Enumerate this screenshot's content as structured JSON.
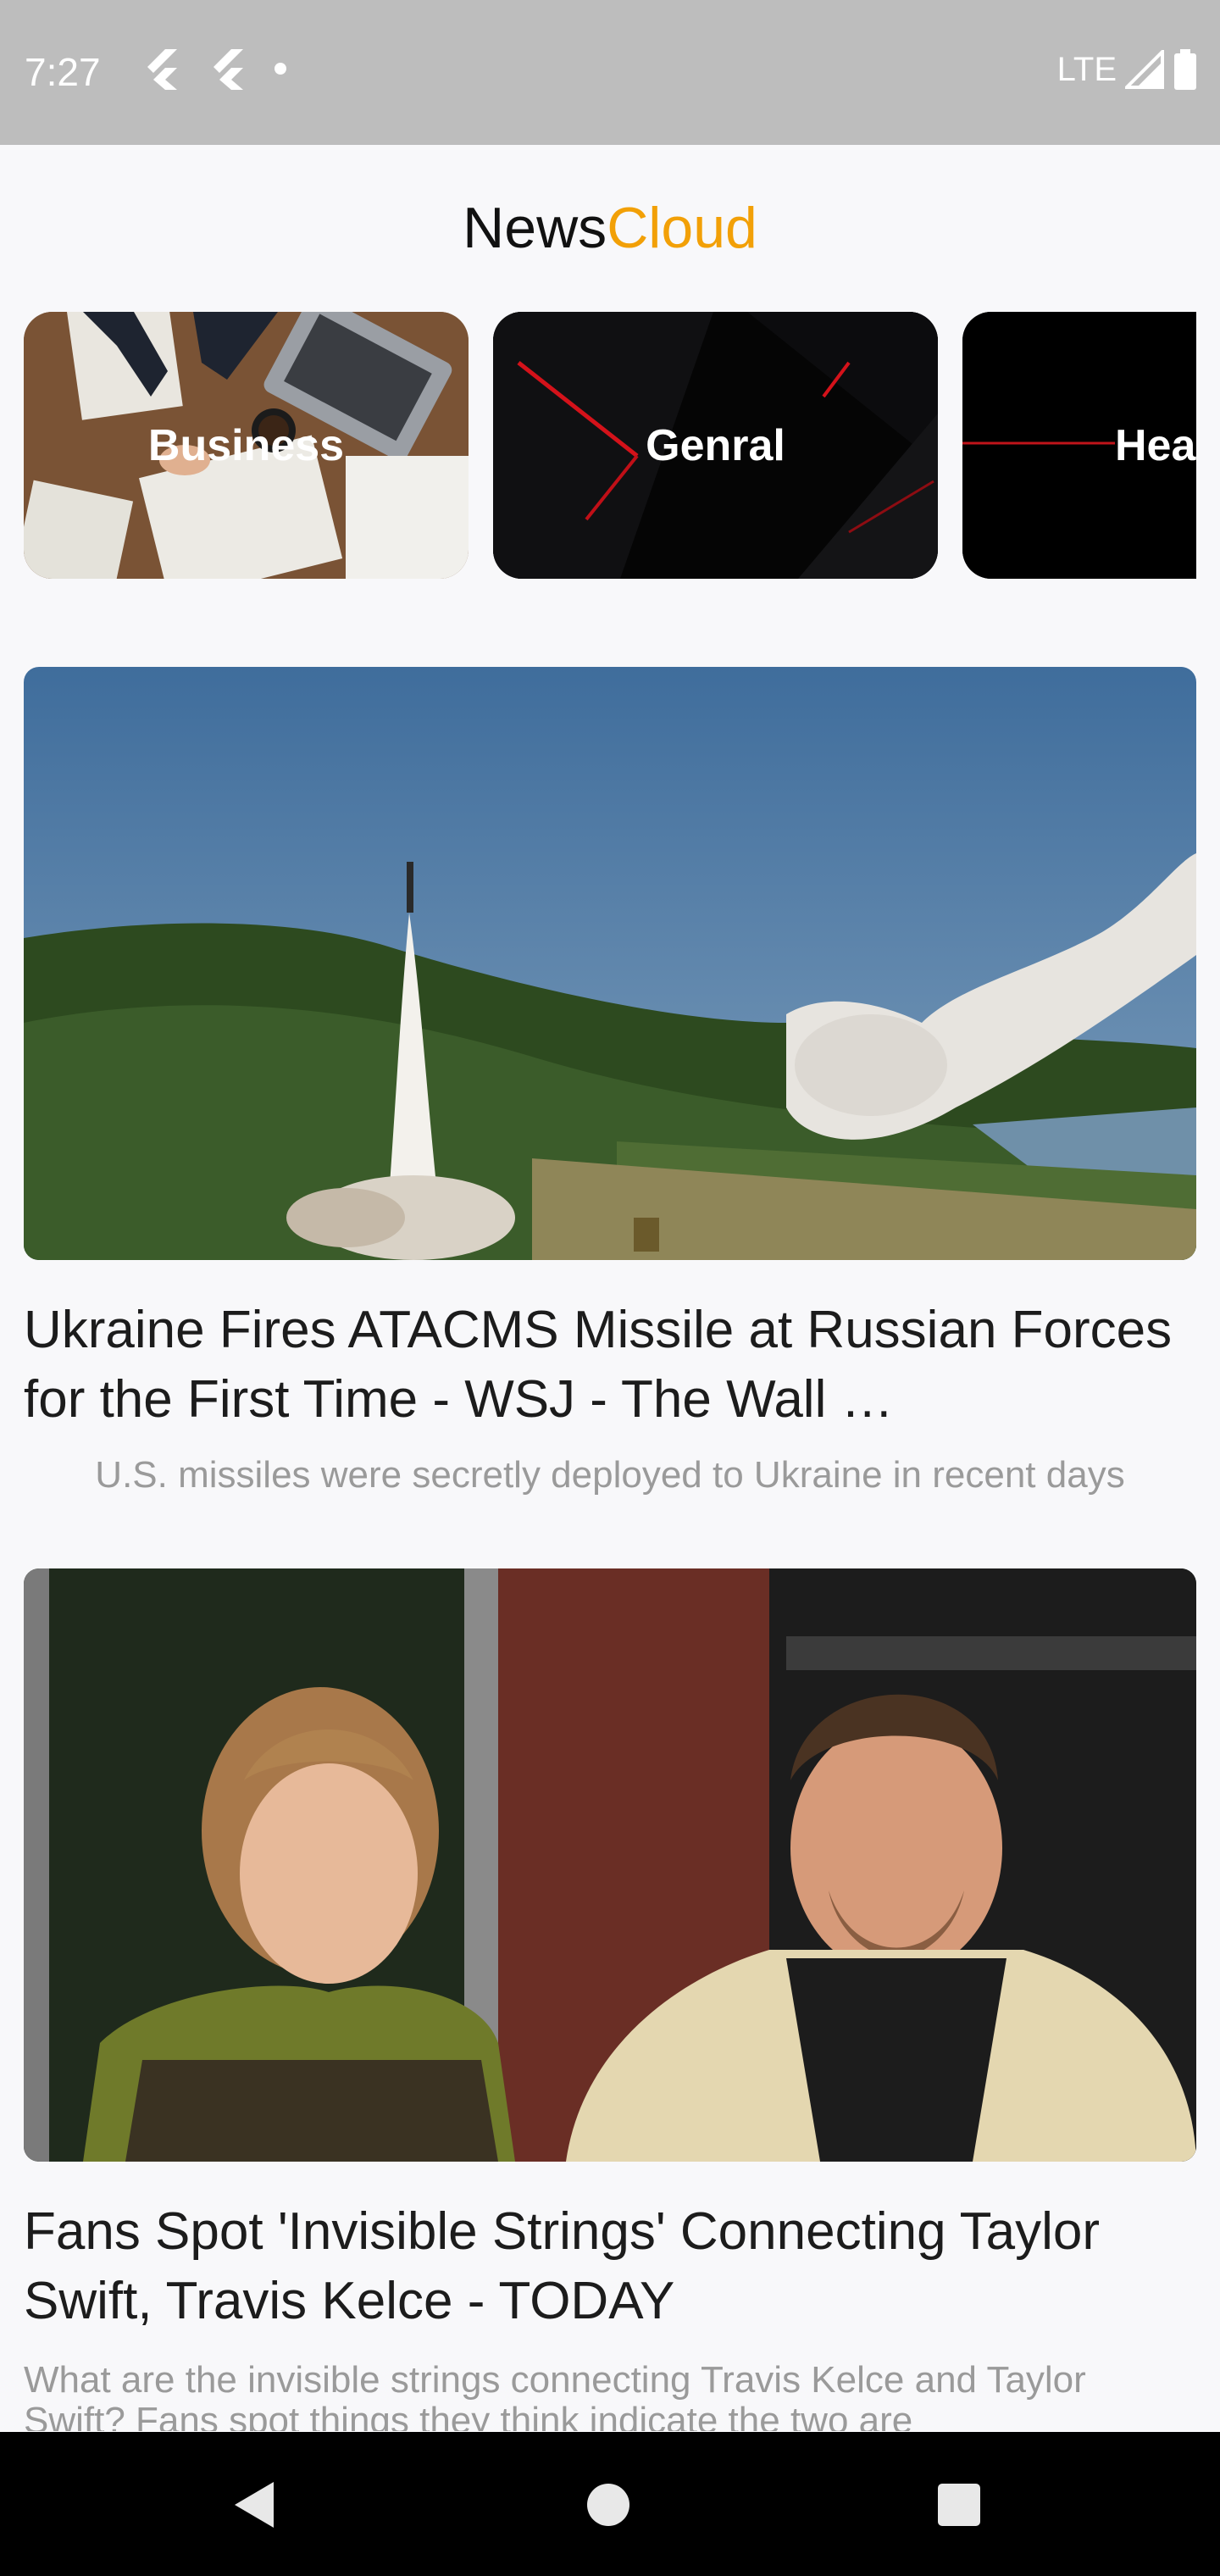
{
  "status_bar": {
    "time": "7:27",
    "network": "LTE",
    "icons": [
      "flutter-icon",
      "flutter-icon",
      "dot-icon",
      "signal-icon",
      "battery-icon"
    ]
  },
  "header": {
    "title_part1": "News",
    "title_part2": "Cloud",
    "accent_color": "#f2a007"
  },
  "categories": [
    {
      "label": "Business"
    },
    {
      "label": "Genral"
    },
    {
      "label": "Hea"
    }
  ],
  "articles": [
    {
      "title": "Ukraine Fires ATACMS Missile at Russian Forces for the First Time - WSJ - The Wall …",
      "description": "U.S. missiles were secretly deployed to Ukraine in recent days"
    },
    {
      "title": "Fans Spot 'Invisible Strings' Connecting Taylor Swift, Travis Kelce - TODAY",
      "description": "What are the invisible strings connecting Travis Kelce and Taylor Swift? Fans spot things they think indicate the two are"
    }
  ],
  "nav_bar": {
    "icons": [
      "back-icon",
      "home-icon",
      "recents-icon"
    ]
  }
}
